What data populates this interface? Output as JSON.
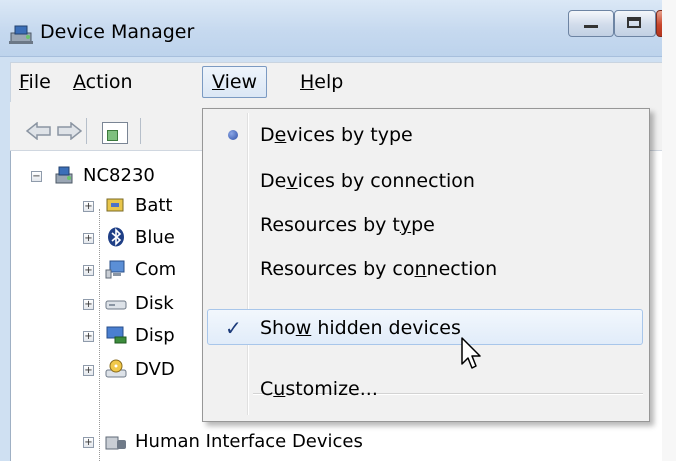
{
  "window": {
    "title": "Device Manager",
    "buttons": {
      "minimize": "minimize",
      "maximize": "maximize",
      "close": "close"
    }
  },
  "menubar": {
    "file": {
      "pre": "",
      "accel": "F",
      "post": "ile"
    },
    "action": {
      "pre": "",
      "accel": "A",
      "post": "ction"
    },
    "view": {
      "pre": "",
      "accel": "V",
      "post": "iew"
    },
    "help": {
      "pre": "",
      "accel": "H",
      "post": "elp"
    }
  },
  "view_menu": {
    "items": [
      {
        "pre": "D",
        "accel": "e",
        "post": "vices by type",
        "mark": "radio",
        "state": "selected"
      },
      {
        "pre": "De",
        "accel": "v",
        "post": "ices by connection",
        "mark": "",
        "state": ""
      },
      {
        "pre": "Resources by t",
        "accel": "y",
        "post": "pe",
        "mark": "",
        "state": ""
      },
      {
        "pre": "Resources by co",
        "accel": "n",
        "post": "nection",
        "mark": "",
        "state": ""
      },
      {
        "pre": "Sho",
        "accel": "w",
        "post": " hidden devices",
        "mark": "check",
        "state": "checked-hover"
      },
      {
        "pre": "C",
        "accel": "u",
        "post": "stomize...",
        "mark": "",
        "state": ""
      }
    ]
  },
  "tree": {
    "root": {
      "label": "NC8230",
      "expander": "−"
    },
    "children": [
      {
        "label": "Batt",
        "icon": "battery-icon",
        "expander": "+"
      },
      {
        "label": "Blue",
        "icon": "bluetooth-icon",
        "expander": "+"
      },
      {
        "label": "Com",
        "icon": "computer-icon",
        "expander": "+"
      },
      {
        "label": "Disk",
        "icon": "disk-drive-icon",
        "expander": "+"
      },
      {
        "label": "Disp",
        "icon": "display-adapter-icon",
        "expander": "+"
      },
      {
        "label": "DVD",
        "icon": "dvd-drive-icon",
        "expander": "+"
      },
      {
        "label": "Human Interface Devices",
        "icon": "hid-icon",
        "expander": "+"
      }
    ]
  },
  "colors": {
    "title_bar": "#c6d9ef",
    "menu_bg": "#f1f1f1",
    "highlight_border": "#a8c6ea",
    "close_button": "#c8452b"
  }
}
